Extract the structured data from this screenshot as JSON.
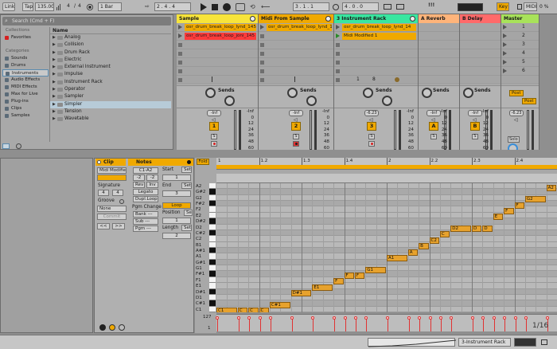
{
  "transport": {
    "link": "Link",
    "tap": "Tap",
    "tempo": "135.00",
    "meter_num": "4",
    "meter_den": "4",
    "quantize": "1 Bar",
    "position": "2 .   4 .   4",
    "loop_start": "3 .   1 .   1",
    "loop_length": "4 .   0 .   0",
    "key": "Key",
    "midi": "MIDI",
    "pct": "0 %",
    "follow_mark": "!!!"
  },
  "browser": {
    "search_placeholder": "Search (Cmd + F)",
    "collections_header": "Collections",
    "collections": [
      {
        "label": "Favorites",
        "color": "#d62020"
      }
    ],
    "categories_header": "Categories",
    "categories": [
      {
        "label": "Sounds",
        "icon": "sounds-icon"
      },
      {
        "label": "Drums",
        "icon": "drums-icon"
      },
      {
        "label": "Instruments",
        "icon": "instruments-icon",
        "selected": true
      },
      {
        "label": "Audio Effects",
        "icon": "audio-effects-icon"
      },
      {
        "label": "MIDI Effects",
        "icon": "midi-effects-icon"
      },
      {
        "label": "Max for Live",
        "icon": "max-for-live-icon"
      },
      {
        "label": "Plug-ins",
        "icon": "plugins-icon"
      },
      {
        "label": "Clips",
        "icon": "clips-icon"
      },
      {
        "label": "Samples",
        "icon": "samples-icon"
      }
    ],
    "name_header": "Name",
    "items": [
      {
        "label": "Analog"
      },
      {
        "label": "Collision"
      },
      {
        "label": "Drum Rack"
      },
      {
        "label": "Electric"
      },
      {
        "label": "External Instrument"
      },
      {
        "label": "Impulse"
      },
      {
        "label": "Instrument Rack"
      },
      {
        "label": "Operator"
      },
      {
        "label": "Sampler"
      },
      {
        "label": "Simpler",
        "selected": true
      },
      {
        "label": "Tension"
      },
      {
        "label": "Wavetable"
      }
    ]
  },
  "tracks": [
    {
      "name": "Sample",
      "color": "#f7e43a",
      "number": "1",
      "clips": [
        {
          "label": "osr_drum_break_loop_lynd_145",
          "color": "#f0a900"
        },
        {
          "label": "osr_drum_break_loop_joni_145",
          "color": "#ff3b3b"
        }
      ],
      "vol": "-Inf",
      "sends": "Sends"
    },
    {
      "name": "Midi From Sample",
      "color": "#f0a900",
      "number": "2",
      "clips": [
        {
          "label": "osr_drum_break_loop_lynd_145",
          "color": "#f0a900"
        }
      ],
      "vol": "-Inf",
      "sends": "Sends"
    },
    {
      "name": "3 Instrument Rack",
      "color": "#39e6a0",
      "number": "3",
      "clips": [
        {
          "label": "osr_drum_break_loop_lynd_14",
          "color": "#f0a900"
        },
        {
          "label": "Midi Modified 1",
          "color": "#f0a900"
        }
      ],
      "vol": "-6.23",
      "sends": "Sends",
      "rack_left": "1",
      "rack_right": "8"
    },
    {
      "name": "A Reverb",
      "color": "#ffb47a",
      "number": "A",
      "clips": [],
      "vol": "-Inf",
      "sends": "Sends"
    },
    {
      "name": "B Delay",
      "color": "#ff6a6a",
      "number": "B",
      "clips": [],
      "vol": "-Inf",
      "sends": "Sends"
    },
    {
      "name": "Master",
      "color": "#a8e25a",
      "number": "",
      "clips": [],
      "vol": "-6.23",
      "sends": "",
      "scenes": [
        "1",
        "2",
        "3",
        "4",
        "5",
        "6"
      ],
      "post_a": "Post",
      "post_b": "Post",
      "solo": "Solo"
    }
  ],
  "db_scale": [
    "-Inf",
    "0",
    "12",
    "24",
    "36",
    "48",
    "60"
  ],
  "clip": {
    "header": "Clip",
    "name": "Midi Modified",
    "signature_label": "Signature",
    "sig_num": "4",
    "sig_den": "4",
    "groove_label": "Groove",
    "groove_value": "None",
    "commit": "Commit",
    "nav_left": "<<",
    "nav_right": ">>"
  },
  "notes": {
    "header": "Notes",
    "range": "C1-A2",
    "transpose_a": "-2",
    "transpose_b": "-2",
    "rev": "Rev",
    "inv": "Inv",
    "legato": "Legato",
    "dupl_loop": "Dupl.Loop",
    "pgm_change": "Pgm Change",
    "bank": "Bank ---",
    "sub": "Sub ---",
    "pgm": "Pgm ---",
    "start_label": "Start",
    "start_val": "1",
    "set": "Set",
    "end_label": "End",
    "end_val": "3",
    "loop": "Loop",
    "position_label": "Position",
    "position_val": "1",
    "length_label": "Length",
    "length_val": "2"
  },
  "editor": {
    "fold": "Fold",
    "bar_labels": [
      "1.2",
      "1.3",
      "1.4",
      "2",
      "2.2",
      "2.3",
      "2.4"
    ],
    "first_bar": "1",
    "keys": [
      "A2",
      "G#2",
      "G2",
      "F#2",
      "F2",
      "E2",
      "D#2",
      "D2",
      "C#2",
      "C2",
      "B1",
      "A#1",
      "A1",
      "G#1",
      "G1",
      "F#1",
      "F1",
      "E1",
      "D#1",
      "D1",
      "C#1",
      "C1"
    ],
    "vel_max": "127",
    "vel_min": "1",
    "grid": "1/16"
  },
  "piano_roll": {
    "total_beats": 8,
    "notes": [
      {
        "pitch": "C1",
        "start": 0.0,
        "dur": 0.5,
        "label": "C1"
      },
      {
        "pitch": "C1",
        "start": 0.5,
        "dur": 0.25,
        "label": "C"
      },
      {
        "pitch": "C1",
        "start": 0.75,
        "dur": 0.25,
        "label": "C"
      },
      {
        "pitch": "C1",
        "start": 1.0,
        "dur": 0.25,
        "label": "C"
      },
      {
        "pitch": "C#1",
        "start": 1.25,
        "dur": 0.5,
        "label": "C#1"
      },
      {
        "pitch": "D#1",
        "start": 1.75,
        "dur": 0.5,
        "label": "D#1"
      },
      {
        "pitch": "E1",
        "start": 2.25,
        "dur": 0.5,
        "label": "E1"
      },
      {
        "pitch": "F1",
        "start": 2.75,
        "dur": 0.25,
        "label": "F"
      },
      {
        "pitch": "F#1",
        "start": 3.0,
        "dur": 0.25,
        "label": "F"
      },
      {
        "pitch": "F#1",
        "start": 3.25,
        "dur": 0.25,
        "label": "F"
      },
      {
        "pitch": "G1",
        "start": 3.5,
        "dur": 0.5,
        "label": "G1"
      },
      {
        "pitch": "A1",
        "start": 4.0,
        "dur": 0.5,
        "label": "A1"
      },
      {
        "pitch": "A#1",
        "start": 4.5,
        "dur": 0.25,
        "label": "A"
      },
      {
        "pitch": "B1",
        "start": 4.75,
        "dur": 0.25,
        "label": "B"
      },
      {
        "pitch": "C2",
        "start": 5.0,
        "dur": 0.25,
        "label": "C2"
      },
      {
        "pitch": "C#2",
        "start": 5.25,
        "dur": 0.25,
        "label": "C"
      },
      {
        "pitch": "D2",
        "start": 5.5,
        "dur": 0.5,
        "label": "D2"
      },
      {
        "pitch": "D2",
        "start": 6.0,
        "dur": 0.25,
        "label": "D"
      },
      {
        "pitch": "D2",
        "start": 6.25,
        "dur": 0.25,
        "label": "D"
      },
      {
        "pitch": "E2",
        "start": 6.5,
        "dur": 0.25,
        "label": "E"
      },
      {
        "pitch": "F2",
        "start": 6.75,
        "dur": 0.25,
        "label": "F"
      },
      {
        "pitch": "F#2",
        "start": 7.0,
        "dur": 0.25,
        "label": "F"
      },
      {
        "pitch": "G2",
        "start": 7.25,
        "dur": 0.5,
        "label": "G2"
      },
      {
        "pitch": "A2",
        "start": 7.75,
        "dur": 0.25,
        "label": "A2"
      }
    ]
  },
  "status": {
    "rack_label": "3-Instrument Rack"
  },
  "colors": {
    "accent": "#f0a900",
    "note": "#e7a22d",
    "velocity": "#e03232",
    "selected_blue": "#5a8bb0"
  }
}
